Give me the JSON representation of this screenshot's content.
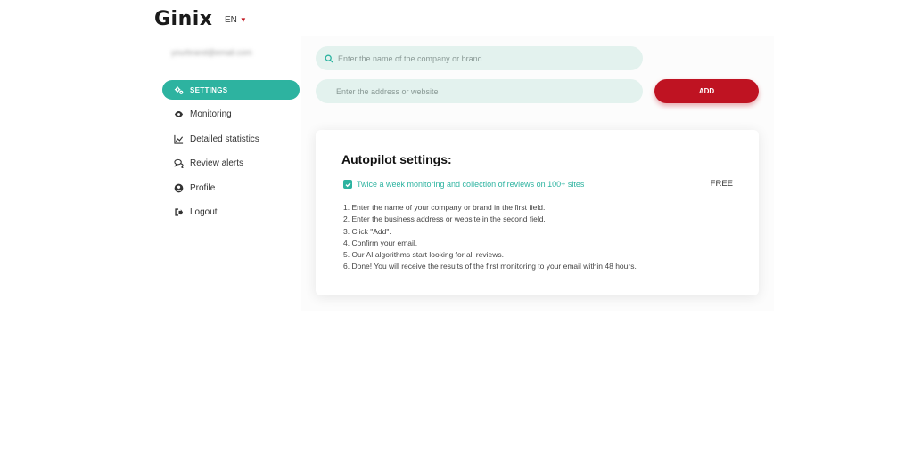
{
  "header": {
    "logo": "Ginix",
    "language": "EN"
  },
  "account": {
    "name": "yourbrand@email.com"
  },
  "sidebar": {
    "items": [
      {
        "label": "SETTINGS",
        "icon": "gears-icon",
        "active": true
      },
      {
        "label": "Monitoring",
        "icon": "eye-icon"
      },
      {
        "label": "Detailed statistics",
        "icon": "line-chart-icon"
      },
      {
        "label": "Review alerts",
        "icon": "chat-bubbles-icon"
      },
      {
        "label": "Profile",
        "icon": "user-icon"
      },
      {
        "label": "Logout",
        "icon": "logout-icon"
      }
    ]
  },
  "form": {
    "company_placeholder": "Enter the name of the company or brand",
    "address_placeholder": "Enter the address or website",
    "add_label": "ADD"
  },
  "autopilot": {
    "title": "Autopilot settings:",
    "option_label": "Twice a week monitoring and collection of reviews on 100+ sites",
    "option_checked": true,
    "price": "FREE",
    "steps": [
      "1. Enter the name of your company or brand in the first field.",
      "2. Enter the business address or website in the second field.",
      "3. Click \"Add\".",
      "4. Confirm your email.",
      "5. Our AI algorithms start looking for all reviews.",
      "6. Done! You will receive the results of the first monitoring to your email within 48 hours."
    ]
  },
  "colors": {
    "accent": "#2db3a0",
    "brand_red": "#bf1322",
    "field_bg": "#e3f2ee"
  }
}
